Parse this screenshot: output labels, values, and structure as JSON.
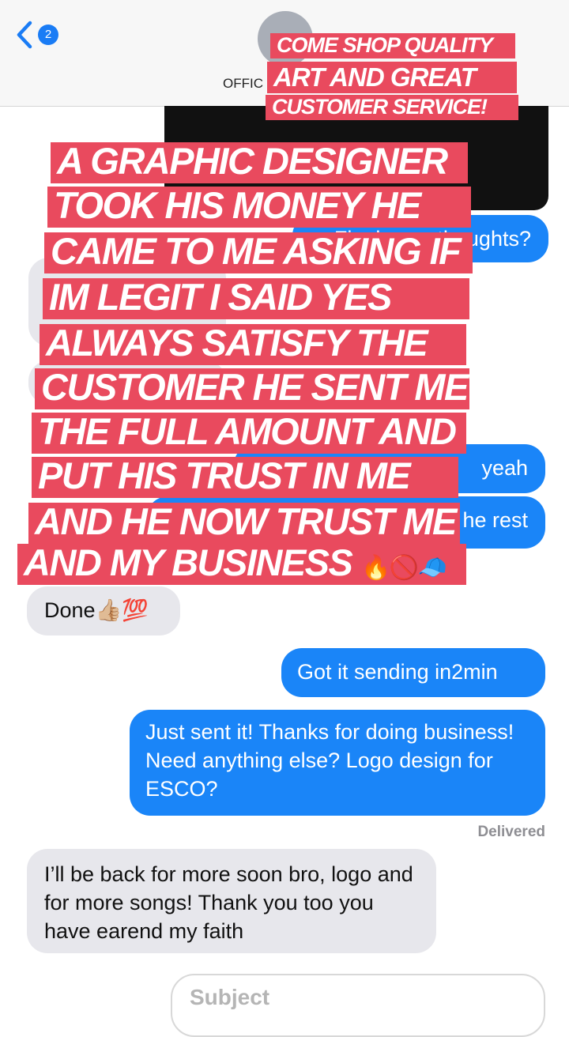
{
  "header": {
    "unread_count": "2",
    "contact_name": "OFFIC"
  },
  "messages": {
    "bg1": "Final copy thoughts?",
    "bg2": "yeah",
    "bg3": "he rest",
    "done": "Done👍🏼💯",
    "got_it": "Got it sending in2min",
    "just_sent": "Just sent it! Thanks for doing business! Need anything else? Logo design for ESCO?",
    "delivered": "Delivered",
    "ill_be_back": "I’ll be back for more soon bro, logo and for more songs! Thank you too you have earend my faith"
  },
  "compose": {
    "subject_placeholder": "Subject"
  },
  "top_caption": [
    "COME SHOP QUALITY",
    "ART AND GREAT",
    "CUSTOMER SERVICE!"
  ],
  "main_caption": [
    "A GRAPHIC DESIGNER",
    "TOOK HIS MONEY HE",
    "CAME TO ME ASKING IF",
    "IM LEGIT I SAID YES",
    "ALWAYS SATISFY THE",
    "CUSTOMER HE SENT ME",
    "THE FULL AMOUNT AND",
    "PUT HIS TRUST IN ME",
    "AND HE NOW TRUST ME",
    "AND MY BUSINESS"
  ],
  "main_caption_emoji": "🔥🚫🧢",
  "colors": {
    "sent_bubble": "#1a85f8",
    "received_bubble": "#e7e7ec",
    "caption_bg": "#e94a5e",
    "badge": "#1a7cf5"
  }
}
